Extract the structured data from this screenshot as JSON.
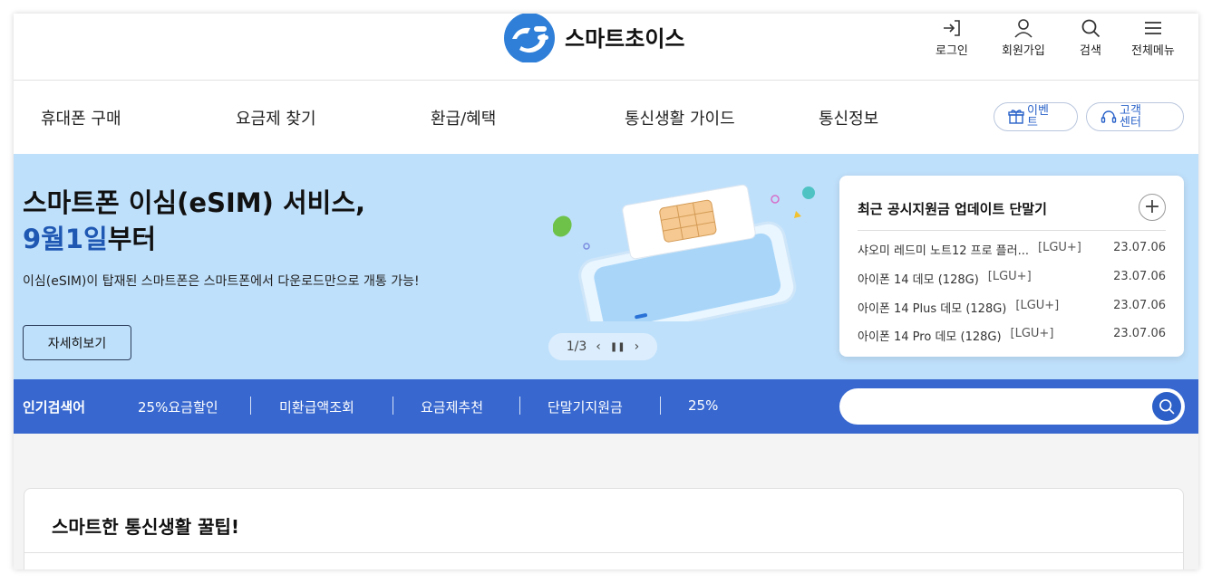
{
  "header": {
    "logo_text": "스마트초이스",
    "login": "로그인",
    "signup": "회원가입",
    "search": "검색",
    "menu": "전체메뉴"
  },
  "nav": {
    "items": [
      "휴대폰 구매",
      "요금제 찾기",
      "환급/혜택",
      "통신생활 가이드",
      "통신정보"
    ],
    "event": "이벤트",
    "support": "고객센터"
  },
  "hero": {
    "title_line1": "스마트폰 이심(eSIM) 서비스,",
    "title_highlight": "9월1일",
    "title_rest": "부터",
    "description": "이심(eSIM)이 탑재된 스마트폰은 스마트폰에서 다운로드만으로 개통 가능!",
    "button": "자세히보기",
    "pager": "1/3"
  },
  "card": {
    "title": "최근 공시지원금 업데이트 단말기",
    "rows": [
      {
        "name": "샤오미 레드미 노트12 프로 플러...",
        "carrier": "[LGU+]",
        "date": "23.07.06"
      },
      {
        "name": "아이폰 14 데모 (128G)",
        "carrier": "[LGU+]",
        "date": "23.07.06"
      },
      {
        "name": "아이폰 14 Plus 데모 (128G)",
        "carrier": "[LGU+]",
        "date": "23.07.06"
      },
      {
        "name": "아이폰 14 Pro 데모 (128G)",
        "carrier": "[LGU+]",
        "date": "23.07.06"
      }
    ]
  },
  "search_bar": {
    "label": "인기검색어",
    "keywords": [
      "25%요금할인",
      "미환급액조회",
      "요금제추천",
      "단말기지원금",
      "25%"
    ],
    "placeholder": ""
  },
  "tips": {
    "title": "스마트한 통신생활 꿀팁!"
  },
  "colors": {
    "brand_blue": "#2f7fd8",
    "search_bar": "#3868cf",
    "hero_bg": "#bfe0fb",
    "highlight": "#1f58b3"
  }
}
